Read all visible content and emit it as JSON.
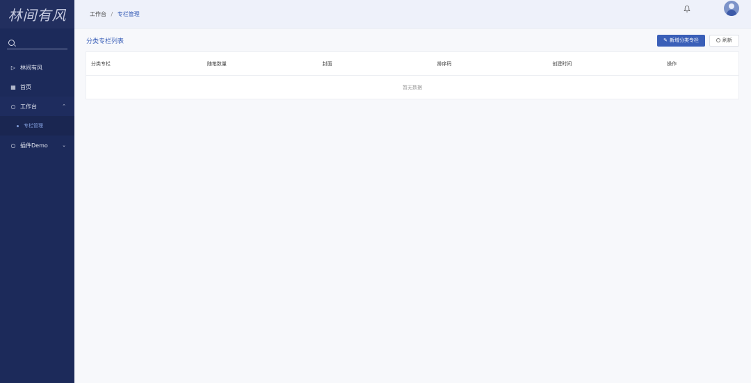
{
  "logo": {
    "text": "林间有风"
  },
  "sidebar": {
    "items": [
      {
        "label": "林间有风",
        "icon": "send-icon"
      },
      {
        "label": "首页",
        "icon": "grid-icon"
      },
      {
        "label": "工作台",
        "icon": "dashboard-icon",
        "expanded": true,
        "children": [
          {
            "label": "专栏管理",
            "active": true
          }
        ]
      },
      {
        "label": "插件Demo",
        "icon": "dashboard-icon",
        "expanded": false
      }
    ]
  },
  "header": {
    "breadcrumb": [
      "工作台",
      "专栏管理"
    ],
    "separator": "/"
  },
  "main": {
    "title": "分类专栏列表",
    "add_button": "新增分类专栏",
    "refresh_button": "刷新",
    "table": {
      "columns": [
        "分类专栏",
        "随笔数量",
        "封面",
        "排序码",
        "创建时间",
        "操作"
      ],
      "empty_text": "暂无数据"
    }
  },
  "colors": {
    "accent": "#3a5fb8",
    "sidebar": "#1c2a5a"
  }
}
